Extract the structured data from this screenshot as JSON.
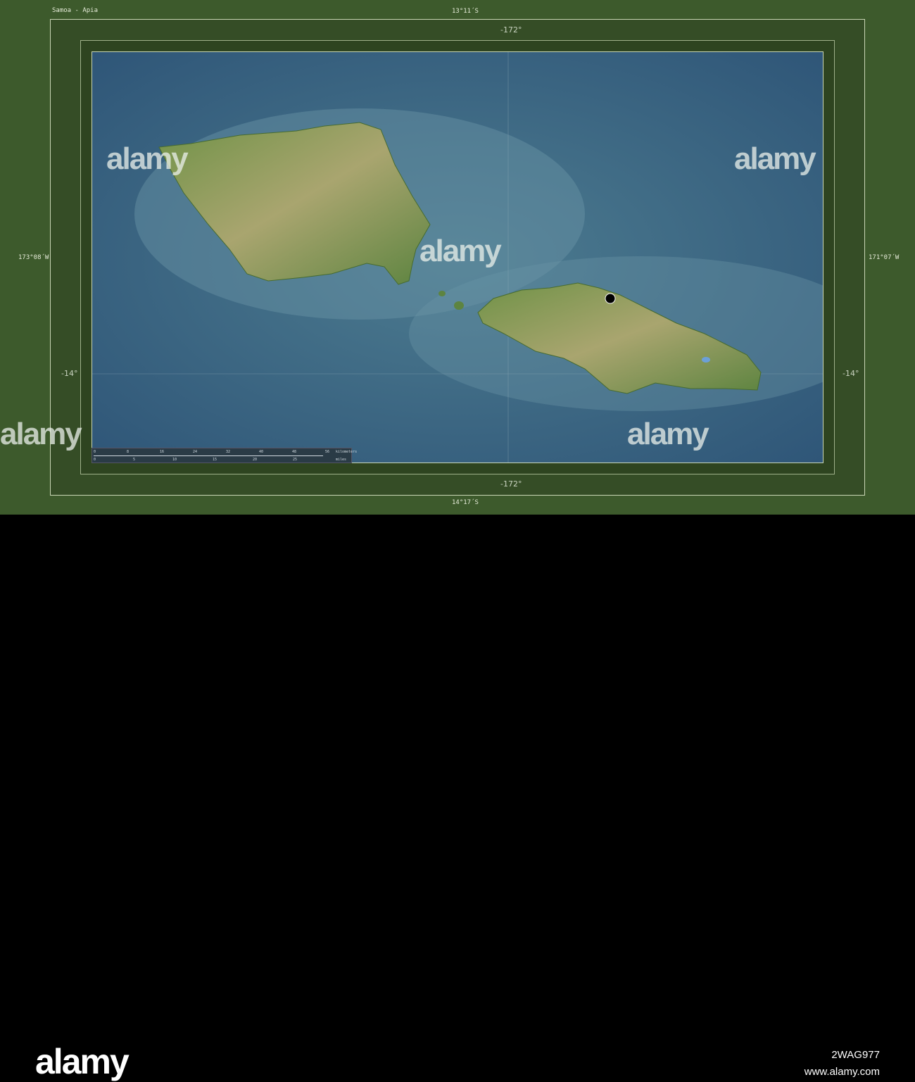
{
  "title": "Samoa - Apia",
  "coords": {
    "top": "13°11´S",
    "bottom": "14°17´S",
    "left": "173°08´W",
    "right": "171°07´W",
    "lon_top": "-172°",
    "lon_bottom": "-172°",
    "lat_left": "-14°",
    "lat_right": "-14°"
  },
  "scale": {
    "km_ticks": [
      "0",
      "8",
      "16",
      "24",
      "32",
      "40",
      "48",
      "56"
    ],
    "km_unit": "kilometers",
    "mi_ticks": [
      "0",
      "5",
      "10",
      "15",
      "20",
      "25"
    ],
    "mi_unit": "miles"
  },
  "watermark": "alamy",
  "footer": {
    "logo": "alamy",
    "image_id": "2WAG977",
    "site": "www.alamy.com"
  },
  "colors": {
    "frame": "#3d5a2c",
    "sea": "#3f6a88",
    "land": "#7f9a55",
    "capital": "#000000"
  }
}
